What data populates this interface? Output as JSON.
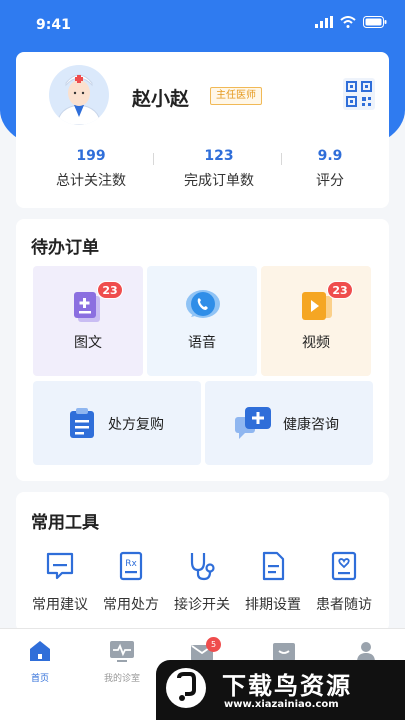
{
  "status_bar": {
    "time": "9:41"
  },
  "profile": {
    "name": "赵小赵",
    "title_badge": "主任医师",
    "stats": [
      {
        "value": "199",
        "label": "总计关注数"
      },
      {
        "value": "123",
        "label": "完成订单数"
      },
      {
        "value": "9.9",
        "label": "评分"
      }
    ]
  },
  "pending": {
    "title": "待办订单",
    "tiles": [
      {
        "label": "图文",
        "badge": "23",
        "icon": "document-add-icon",
        "color": "#8b6fe0"
      },
      {
        "label": "语音",
        "badge": "",
        "icon": "phone-chat-icon",
        "color": "#2f8ee8"
      },
      {
        "label": "视频",
        "badge": "23",
        "icon": "video-play-icon",
        "color": "#f5a623"
      },
      {
        "label": "处方复购",
        "icon": "clipboard-icon",
        "color": "#2f6ed9"
      },
      {
        "label": "健康咨询",
        "icon": "chat-plus-icon",
        "color": "#2f6ed9"
      }
    ]
  },
  "tools": {
    "title": "常用工具",
    "items": [
      {
        "label": "常用建议",
        "icon": "message-icon"
      },
      {
        "label": "常用处方",
        "icon": "prescription-icon"
      },
      {
        "label": "接诊开关",
        "icon": "stethoscope-icon"
      },
      {
        "label": "排期设置",
        "icon": "schedule-file-icon"
      },
      {
        "label": "患者随访",
        "icon": "heart-card-icon"
      }
    ]
  },
  "tabbar": {
    "items": [
      {
        "label": "首页",
        "icon": "home-icon",
        "active": true
      },
      {
        "label": "我的诊室",
        "icon": "monitor-pulse-icon",
        "active": false
      },
      {
        "label": "",
        "icon": "mail-icon",
        "badge": "5",
        "active": false
      },
      {
        "label": "",
        "icon": "inbox-icon",
        "active": false
      },
      {
        "label": "",
        "icon": "user-icon",
        "active": false
      }
    ]
  },
  "watermark": {
    "title": "下载鸟资源",
    "url": "www.xiazainiao.com"
  },
  "colors": {
    "primary": "#2f7bf0",
    "badge": "#ef4d4d",
    "accent_orange": "#e59a1f"
  }
}
